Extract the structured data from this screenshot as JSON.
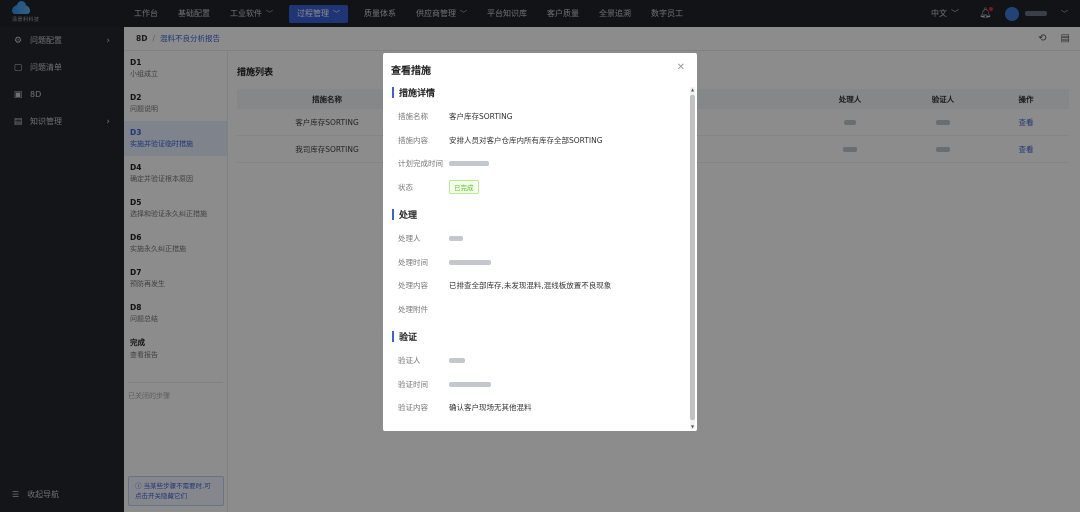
{
  "brand": {
    "name": "清景利科技"
  },
  "nav": {
    "items": [
      {
        "label": "工作台",
        "chevron": false
      },
      {
        "label": "基础配置",
        "chevron": false
      },
      {
        "label": "工业软件",
        "chevron": true
      },
      {
        "label": "过程管理",
        "chevron": true,
        "active": true
      },
      {
        "label": "质量体系",
        "chevron": false
      },
      {
        "label": "供应商管理",
        "chevron": true
      },
      {
        "label": "平台知识库",
        "chevron": false
      },
      {
        "label": "客户质量",
        "chevron": false
      },
      {
        "label": "全景追溯",
        "chevron": false
      },
      {
        "label": "数字员工",
        "chevron": false
      }
    ],
    "language": "中文"
  },
  "sidebar": {
    "items": [
      {
        "label": "问题配置",
        "icon": "gear-icon",
        "arrow": true
      },
      {
        "label": "问题清单",
        "icon": "list-icon",
        "arrow": false
      },
      {
        "label": "8D",
        "icon": "8d-icon",
        "arrow": false
      },
      {
        "label": "知识管理",
        "icon": "book-icon",
        "arrow": true
      }
    ],
    "collapse_label": "收起导航"
  },
  "breadcrumb": {
    "root": "8D",
    "separator": "/",
    "current": "混料不良分析报告"
  },
  "steps": {
    "items": [
      {
        "code": "D1",
        "desc": "小组成立"
      },
      {
        "code": "D2",
        "desc": "问题说明"
      },
      {
        "code": "D3",
        "desc": "实施并验证临时措施",
        "active": true
      },
      {
        "code": "D4",
        "desc": "确定并验证根本原因"
      },
      {
        "code": "D5",
        "desc": "选择和验证永久纠正措施"
      },
      {
        "code": "D6",
        "desc": "实施永久纠正措施"
      },
      {
        "code": "D7",
        "desc": "预防再发生"
      },
      {
        "code": "D8",
        "desc": "问题总结"
      },
      {
        "code": "完成",
        "desc": "查看报告"
      }
    ],
    "closed_steps": "已关闭的步骤",
    "tip": "当某些步骤不需要时,可点击开关隐藏它们"
  },
  "main": {
    "title": "措施列表",
    "columns": [
      "措施名称",
      "",
      "处理人",
      "验证人",
      "操作"
    ],
    "rows": [
      {
        "name": "客户库存SORTING",
        "action": "查看"
      },
      {
        "name": "我司库存SORTING",
        "action": "查看"
      }
    ]
  },
  "modal": {
    "title": "查看措施",
    "sections": {
      "measure": {
        "title": "措施详情",
        "name_label": "措施名称",
        "name_value": "客户库存SORTING",
        "content_label": "措施内容",
        "content_value": "安排人员对客户仓库内所有库存全部SORTING",
        "plan_label": "计划完成时间",
        "status_label": "状态",
        "status_value": "已完成"
      },
      "handle": {
        "title": "处理",
        "handler_label": "处理人",
        "time_label": "处理时间",
        "content_label": "处理内容",
        "content_value": "已排查全部库存,未发现混料,混线板放置不良现象",
        "attach_label": "处理附件"
      },
      "verify": {
        "title": "验证",
        "verifier_label": "验证人",
        "time_label": "验证时间",
        "content_label": "验证内容",
        "content_value": "确认客户现场无其他混料"
      }
    }
  },
  "colors": {
    "accent": "#3a62d7",
    "topbar": "#1f2329",
    "sidebar": "#23272e",
    "success": "#52c41a"
  }
}
